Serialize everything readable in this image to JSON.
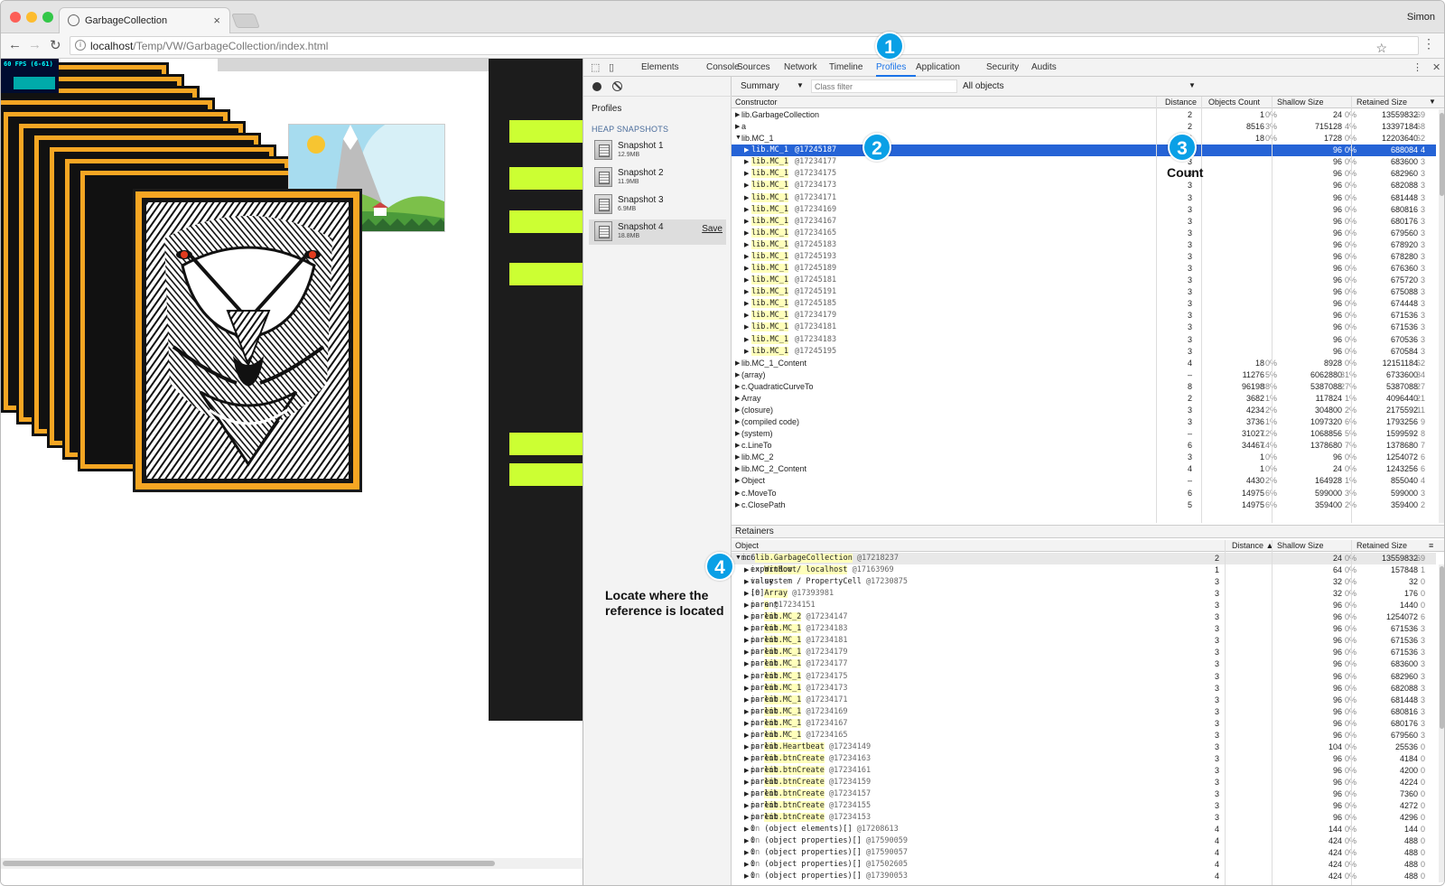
{
  "browser": {
    "tab_title": "GarbageCollection",
    "tab_close": "×",
    "user": "Simon",
    "url_host": "localhost",
    "url_path": "/Temp/VW/GarbageCollection/index.html",
    "nav_back": "←",
    "nav_forward": "→",
    "nav_reload": "↻",
    "star": "☆",
    "menu": "⋮",
    "colors": {
      "close": "#fc5f57",
      "minimize": "#fdbc2e",
      "maximize": "#33c748"
    }
  },
  "page": {
    "fps_label": "60 FPS (6-61)",
    "colors": {
      "frame": "#f5a623",
      "lime": "#ccff33",
      "panel": "#1c1c1c"
    }
  },
  "devtools": {
    "tabs": [
      "Elements",
      "Console",
      "Sources",
      "Network",
      "Timeline",
      "Profiles",
      "Application",
      "Security",
      "Audits"
    ],
    "active_tab": "Profiles",
    "icons": {
      "inspect": "⬚",
      "device": "▯",
      "kebab": "⋮",
      "close": "✕"
    },
    "sidebar": {
      "profiles_label": "Profiles",
      "heap_label": "HEAP SNAPSHOTS",
      "snapshots": [
        {
          "name": "Snapshot 1",
          "size": "12.9MB"
        },
        {
          "name": "Snapshot 2",
          "size": "11.9MB"
        },
        {
          "name": "Snapshot 3",
          "size": "6.9MB"
        },
        {
          "name": "Snapshot 4",
          "size": "18.8MB",
          "save": "Save"
        }
      ]
    },
    "filter": {
      "view": "Summary",
      "class_filter_placeholder": "Class filter",
      "objects": "All objects"
    },
    "summary_columns": [
      "Constructor",
      "Distance",
      "Objects Count",
      "Shallow Size",
      "Retained Size"
    ],
    "summary_rows": [
      [
        "▶",
        "lib.GarbageCollection",
        "",
        "2",
        "1",
        "0%",
        "24",
        "0%",
        "13559832",
        "69"
      ],
      [
        "▶",
        "a",
        "",
        "2",
        "8516",
        "3%",
        "715128",
        "4%",
        "13397184",
        "68"
      ],
      [
        "▼",
        "lib.MC_1",
        "",
        "3",
        "18",
        "0%",
        "1728",
        "0%",
        "12203640",
        "62"
      ],
      [
        "▶",
        "lib.MC_1",
        "@17245187",
        "3",
        "",
        "",
        "96",
        "0%",
        "688084",
        "4"
      ],
      [
        "▶",
        "lib.MC_1",
        "@17234177",
        "3",
        "",
        "",
        "96",
        "0%",
        "683600",
        "3"
      ],
      [
        "▶",
        "lib.MC_1",
        "@17234175",
        "3",
        "",
        "",
        "96",
        "0%",
        "682960",
        "3"
      ],
      [
        "▶",
        "lib.MC_1",
        "@17234173",
        "3",
        "",
        "",
        "96",
        "0%",
        "682088",
        "3"
      ],
      [
        "▶",
        "lib.MC_1",
        "@17234171",
        "3",
        "",
        "",
        "96",
        "0%",
        "681448",
        "3"
      ],
      [
        "▶",
        "lib.MC_1",
        "@17234169",
        "3",
        "",
        "",
        "96",
        "0%",
        "680816",
        "3"
      ],
      [
        "▶",
        "lib.MC_1",
        "@17234167",
        "3",
        "",
        "",
        "96",
        "0%",
        "680176",
        "3"
      ],
      [
        "▶",
        "lib.MC_1",
        "@17234165",
        "3",
        "",
        "",
        "96",
        "0%",
        "679560",
        "3"
      ],
      [
        "▶",
        "lib.MC_1",
        "@17245183",
        "3",
        "",
        "",
        "96",
        "0%",
        "678920",
        "3"
      ],
      [
        "▶",
        "lib.MC_1",
        "@17245193",
        "3",
        "",
        "",
        "96",
        "0%",
        "678280",
        "3"
      ],
      [
        "▶",
        "lib.MC_1",
        "@17245189",
        "3",
        "",
        "",
        "96",
        "0%",
        "676360",
        "3"
      ],
      [
        "▶",
        "lib.MC_1",
        "@17245181",
        "3",
        "",
        "",
        "96",
        "0%",
        "675720",
        "3"
      ],
      [
        "▶",
        "lib.MC_1",
        "@17245191",
        "3",
        "",
        "",
        "96",
        "0%",
        "675088",
        "3"
      ],
      [
        "▶",
        "lib.MC_1",
        "@17245185",
        "3",
        "",
        "",
        "96",
        "0%",
        "674448",
        "3"
      ],
      [
        "▶",
        "lib.MC_1",
        "@17234179",
        "3",
        "",
        "",
        "96",
        "0%",
        "671536",
        "3"
      ],
      [
        "▶",
        "lib.MC_1",
        "@17234181",
        "3",
        "",
        "",
        "96",
        "0%",
        "671536",
        "3"
      ],
      [
        "▶",
        "lib.MC_1",
        "@17234183",
        "3",
        "",
        "",
        "96",
        "0%",
        "670536",
        "3"
      ],
      [
        "▶",
        "lib.MC_1",
        "@17245195",
        "3",
        "",
        "",
        "96",
        "0%",
        "670584",
        "3"
      ],
      [
        "▶",
        "lib.MC_1_Content",
        "",
        "4",
        "18",
        "0%",
        "8928",
        "0%",
        "12151184",
        "62"
      ],
      [
        "▶",
        "(array)",
        "",
        "–",
        "11276",
        "5%",
        "6062880",
        "31%",
        "6733600",
        "34"
      ],
      [
        "▶",
        "c.QuadraticCurveTo",
        "",
        "8",
        "96198",
        "38%",
        "5387088",
        "27%",
        "5387088",
        "27"
      ],
      [
        "▶",
        "Array",
        "",
        "2",
        "3682",
        "1%",
        "117824",
        "1%",
        "4096440",
        "21"
      ],
      [
        "▶",
        "(closure)",
        "",
        "3",
        "4234",
        "2%",
        "304800",
        "2%",
        "2175592",
        "11"
      ],
      [
        "▶",
        "(compiled code)",
        "",
        "3",
        "3736",
        "1%",
        "1097320",
        "6%",
        "1793256",
        "9"
      ],
      [
        "▶",
        "(system)",
        "",
        "–",
        "31027",
        "12%",
        "1068856",
        "5%",
        "1599592",
        "8"
      ],
      [
        "▶",
        "c.LineTo",
        "",
        "6",
        "34467",
        "14%",
        "1378680",
        "7%",
        "1378680",
        "7"
      ],
      [
        "▶",
        "lib.MC_2",
        "",
        "3",
        "1",
        "0%",
        "96",
        "0%",
        "1254072",
        "6"
      ],
      [
        "▶",
        "lib.MC_2_Content",
        "",
        "4",
        "1",
        "0%",
        "24",
        "0%",
        "1243256",
        "6"
      ],
      [
        "▶",
        "Object",
        "",
        "–",
        "4430",
        "2%",
        "164928",
        "1%",
        "855040",
        "4"
      ],
      [
        "▶",
        "c.MoveTo",
        "",
        "6",
        "14975",
        "6%",
        "599000",
        "3%",
        "599000",
        "3"
      ],
      [
        "▶",
        "c.ClosePath",
        "",
        "5",
        "14975",
        "6%",
        "359400",
        "2%",
        "359400",
        "2"
      ]
    ],
    "retainers_label": "Retainers",
    "retainer_columns": [
      "Object",
      "Distance ▲",
      "Shallow Size",
      "Retained Size"
    ],
    "retainer_rows": [
      [
        "▼",
        "mc6",
        " in ",
        "lib.GarbageCollection",
        "@17218237",
        "2",
        "24",
        "0%",
        "13559832",
        "69"
      ],
      [
        "▶",
        "exportRoot",
        " in ",
        "Window / localhost",
        "@17163969",
        "1",
        "64",
        "0%",
        "157848",
        "1"
      ],
      [
        "▶",
        "value",
        " in ",
        "system / PropertyCell",
        "@17230875",
        "3",
        "32",
        "0%",
        "32",
        "0"
      ],
      [
        "▶",
        "[0]",
        " in ",
        "Array",
        "@17393981",
        "3",
        "32",
        "0%",
        "176",
        "0"
      ],
      [
        "▶",
        "parent",
        " in ",
        "a",
        "@17234151",
        "3",
        "96",
        "0%",
        "1440",
        "0"
      ],
      [
        "▶",
        "parent",
        " in ",
        "lib.MC_2",
        "@17234147",
        "3",
        "96",
        "0%",
        "1254072",
        "6"
      ],
      [
        "▶",
        "parent",
        " in ",
        "lib.MC_1",
        "@17234183",
        "3",
        "96",
        "0%",
        "671536",
        "3"
      ],
      [
        "▶",
        "parent",
        " in ",
        "lib.MC_1",
        "@17234181",
        "3",
        "96",
        "0%",
        "671536",
        "3"
      ],
      [
        "▶",
        "parent",
        " in ",
        "lib.MC_1",
        "@17234179",
        "3",
        "96",
        "0%",
        "671536",
        "3"
      ],
      [
        "▶",
        "parent",
        " in ",
        "lib.MC_1",
        "@17234177",
        "3",
        "96",
        "0%",
        "683600",
        "3"
      ],
      [
        "▶",
        "parent",
        " in ",
        "lib.MC_1",
        "@17234175",
        "3",
        "96",
        "0%",
        "682960",
        "3"
      ],
      [
        "▶",
        "parent",
        " in ",
        "lib.MC_1",
        "@17234173",
        "3",
        "96",
        "0%",
        "682088",
        "3"
      ],
      [
        "▶",
        "parent",
        " in ",
        "lib.MC_1",
        "@17234171",
        "3",
        "96",
        "0%",
        "681448",
        "3"
      ],
      [
        "▶",
        "parent",
        " in ",
        "lib.MC_1",
        "@17234169",
        "3",
        "96",
        "0%",
        "680816",
        "3"
      ],
      [
        "▶",
        "parent",
        " in ",
        "lib.MC_1",
        "@17234167",
        "3",
        "96",
        "0%",
        "680176",
        "3"
      ],
      [
        "▶",
        "parent",
        " in ",
        "lib.MC_1",
        "@17234165",
        "3",
        "96",
        "0%",
        "679560",
        "3"
      ],
      [
        "▶",
        "parent",
        " in ",
        "lib.Heartbeat",
        "@17234149",
        "3",
        "104",
        "0%",
        "25536",
        "0"
      ],
      [
        "▶",
        "parent",
        " in ",
        "lib.btnCreate",
        "@17234163",
        "3",
        "96",
        "0%",
        "4184",
        "0"
      ],
      [
        "▶",
        "parent",
        " in ",
        "lib.btnCreate",
        "@17234161",
        "3",
        "96",
        "0%",
        "4200",
        "0"
      ],
      [
        "▶",
        "parent",
        " in ",
        "lib.btnCreate",
        "@17234159",
        "3",
        "96",
        "0%",
        "4224",
        "0"
      ],
      [
        "▶",
        "parent",
        " in ",
        "lib.btnCreate",
        "@17234157",
        "3",
        "96",
        "0%",
        "7360",
        "0"
      ],
      [
        "▶",
        "parent",
        " in ",
        "lib.btnCreate",
        "@17234155",
        "3",
        "96",
        "0%",
        "4272",
        "0"
      ],
      [
        "▶",
        "parent",
        " in ",
        "lib.btnCreate",
        "@17234153",
        "3",
        "96",
        "0%",
        "4296",
        "0"
      ],
      [
        "▶",
        "0",
        " in ",
        "(object elements)[]",
        "@17208613",
        "4",
        "144",
        "0%",
        "144",
        "0"
      ],
      [
        "▶",
        "0",
        " in ",
        "(object properties)[]",
        "@17590059",
        "4",
        "424",
        "0%",
        "488",
        "0"
      ],
      [
        "▶",
        "0",
        " in ",
        "(object properties)[]",
        "@17590057",
        "4",
        "424",
        "0%",
        "488",
        "0"
      ],
      [
        "▶",
        "0",
        " in ",
        "(object properties)[]",
        "@17502605",
        "4",
        "424",
        "0%",
        "488",
        "0"
      ],
      [
        "▶",
        "0",
        " in ",
        "(object properties)[]",
        "@17390053",
        "4",
        "424",
        "0%",
        "488",
        "0"
      ]
    ]
  },
  "annotations": {
    "badges": [
      "1",
      "2",
      "3",
      "4"
    ],
    "count_label": "Count",
    "locate_label": "Locate where the reference is located",
    "badge_color": "#0aa0e6"
  }
}
